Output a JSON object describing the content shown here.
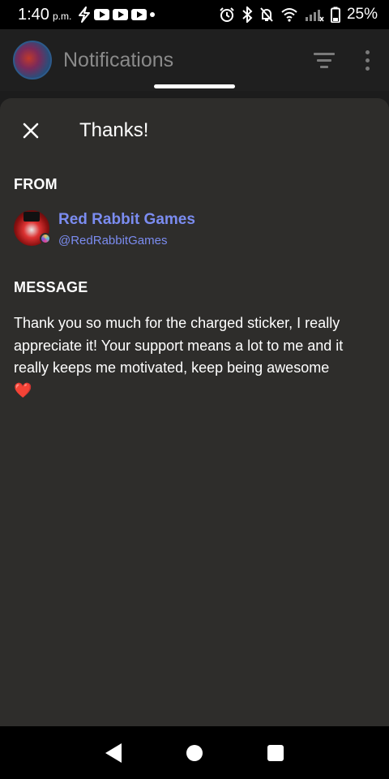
{
  "status_bar": {
    "time": "1:40",
    "ampm": "p.m.",
    "battery": "25%",
    "icons": [
      "bolt-icon",
      "youtube-icon",
      "youtube-icon",
      "youtube-icon",
      "dot-icon",
      "alarm-icon",
      "bluetooth-icon",
      "notifications-off-icon",
      "wifi-icon",
      "signal-icon",
      "battery-icon"
    ]
  },
  "app_header": {
    "title": "Notifications",
    "actions": [
      "filter-icon",
      "more-vert-icon"
    ]
  },
  "sheet": {
    "title": "Thanks!",
    "from_label": "FROM",
    "sender": {
      "name": "Red Rabbit Games",
      "handle": "@RedRabbitGames"
    },
    "message_label": "MESSAGE",
    "message": "Thank you so much for the charged sticker, I really appreciate it! Your support means a lot to me and it really keeps me motivated, keep being awesome",
    "emoji": "❤️"
  },
  "colors": {
    "accent": "#7b8cf0",
    "sheet_bg": "#2e2d2b",
    "heart": "#e0443b"
  },
  "nav_bar": {
    "buttons": [
      "back-icon",
      "home-icon",
      "recents-icon"
    ]
  }
}
